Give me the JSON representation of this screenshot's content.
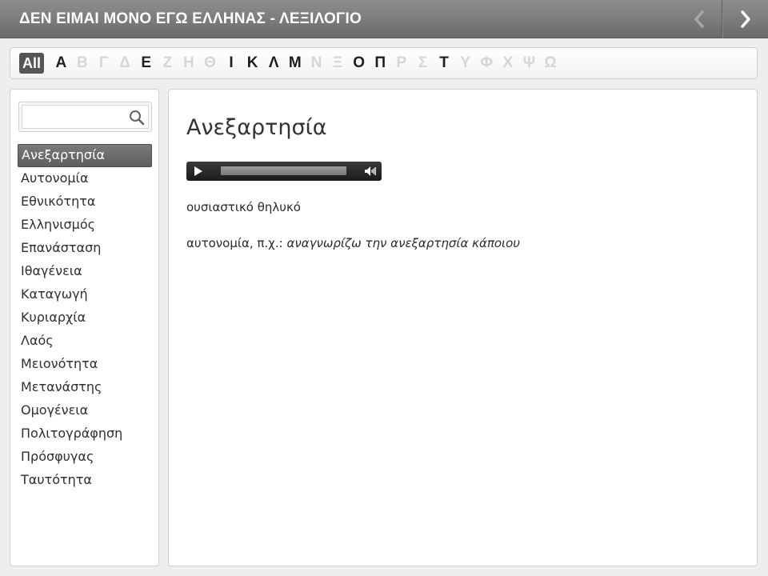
{
  "header": {
    "title": "ΔΕΝ ΕΙΜΑΙ ΜΟΝΟ ΕΓΩ ΕΛΛΗΝΑΣ - ΛΕΞΙΛΟΓΙΟ",
    "prev_icon": "chevron-left-icon",
    "next_icon": "chevron-right-icon"
  },
  "alphabet": {
    "all_label": "All",
    "letters": [
      {
        "label": "Α",
        "enabled": true
      },
      {
        "label": "Β",
        "enabled": false
      },
      {
        "label": "Γ",
        "enabled": false
      },
      {
        "label": "Δ",
        "enabled": false
      },
      {
        "label": "Ε",
        "enabled": true
      },
      {
        "label": "Ζ",
        "enabled": false
      },
      {
        "label": "Η",
        "enabled": false
      },
      {
        "label": "Θ",
        "enabled": false
      },
      {
        "label": "Ι",
        "enabled": true
      },
      {
        "label": "Κ",
        "enabled": true
      },
      {
        "label": "Λ",
        "enabled": true
      },
      {
        "label": "Μ",
        "enabled": true
      },
      {
        "label": "Ν",
        "enabled": false
      },
      {
        "label": "Ξ",
        "enabled": false
      },
      {
        "label": "Ο",
        "enabled": true
      },
      {
        "label": "Π",
        "enabled": true
      },
      {
        "label": "Ρ",
        "enabled": false
      },
      {
        "label": "Σ",
        "enabled": false
      },
      {
        "label": "Τ",
        "enabled": true
      },
      {
        "label": "Υ",
        "enabled": false
      },
      {
        "label": "Φ",
        "enabled": false
      },
      {
        "label": "Χ",
        "enabled": false
      },
      {
        "label": "Ψ",
        "enabled": false
      },
      {
        "label": "Ω",
        "enabled": false
      }
    ]
  },
  "search": {
    "value": "",
    "placeholder": "",
    "icon": "search-icon"
  },
  "words": {
    "selected_index": 0,
    "items": [
      "Ανεξαρτησία",
      "Αυτονομία",
      "Εθνικότητα",
      "Ελληνισμός",
      "Επανάσταση",
      "Ιθαγένεια",
      "Καταγωγή",
      "Κυριαρχία",
      "Λαός",
      "Μειονότητα",
      "Μετανάστης",
      "Ομογένεια",
      "Πολιτογράφηση",
      "Πρόσφυγας",
      "Ταυτότητα"
    ]
  },
  "entry": {
    "title": "Ανεξαρτησία",
    "part_of_speech": "ουσιαστικό θηλυκό",
    "definition": "αυτονομία, π.χ.: ",
    "example": "αναγνωρίζω την ανεξαρτησία κάποιου",
    "audio": {
      "play_icon": "play-icon",
      "volume_icon": "volume-icon"
    }
  },
  "colors": {
    "titlebar": "#7d7d7d",
    "active_item": "#666666",
    "disabled_letter": "#d6d6d6"
  }
}
